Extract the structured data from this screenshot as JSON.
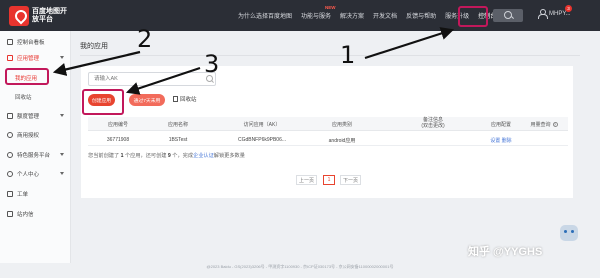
{
  "header": {
    "logo_text": "百度地图开放平台",
    "nav": [
      {
        "label": "为什么选择百度地图"
      },
      {
        "label": "功能与服务"
      },
      {
        "label": "解决方案"
      },
      {
        "label": "开发文档"
      },
      {
        "label": "反馈与帮助"
      },
      {
        "label": "服务升级"
      },
      {
        "label": "控制台"
      }
    ],
    "new_badge": "NEW",
    "user_name": "MHPY...",
    "notification_count": "3"
  },
  "sidebar": {
    "items": [
      {
        "label": "控制台看板"
      },
      {
        "label": "应用管理"
      },
      {
        "label": "额度管理"
      },
      {
        "label": "商用授权"
      },
      {
        "label": "特色服务平台"
      },
      {
        "label": "个人中心"
      },
      {
        "label": "工单"
      },
      {
        "label": "站内信"
      }
    ],
    "sub_items": [
      {
        "label": "我的应用"
      },
      {
        "label": "回收站"
      }
    ]
  },
  "main": {
    "page_title": "我的应用",
    "search_placeholder": "请输入AK",
    "create_button": "创建应用",
    "batch_button": "通过7天未用",
    "recycle_label": "回收站",
    "table": {
      "headers": [
        "应用编号",
        "应用名称",
        "访问应用（AK）",
        "应用类别",
        "备注信息\n(双击更改)",
        "应用配置",
        "用量查询"
      ],
      "header_note": "双击更改",
      "rows": [
        {
          "id": "36771908",
          "name": "1BSTest",
          "ak": "CGdBNFP6k9PB06...",
          "type": "android应用",
          "note": "",
          "config": "设置  删除",
          "usage": ""
        }
      ]
    },
    "summary": {
      "prefix": "您当前创建了",
      "count": "1",
      "middle": "个应用，还可创建",
      "remaining": "9",
      "suffix1": "个，完成",
      "link": "企业认证",
      "suffix2": "解锁更多数量"
    },
    "pager": {
      "prev": "上一页",
      "current": "1",
      "next": "下一页"
    }
  },
  "footer": {
    "text": "@2023 Baidu - GS(2023)3206号 - 甲测资字1100930 - 京ICP证030173号 - 京公网安备11000002000001号"
  },
  "watermark": "知乎 @YYGHS",
  "annotations": {
    "one": "1",
    "two": "2",
    "three": "3"
  }
}
